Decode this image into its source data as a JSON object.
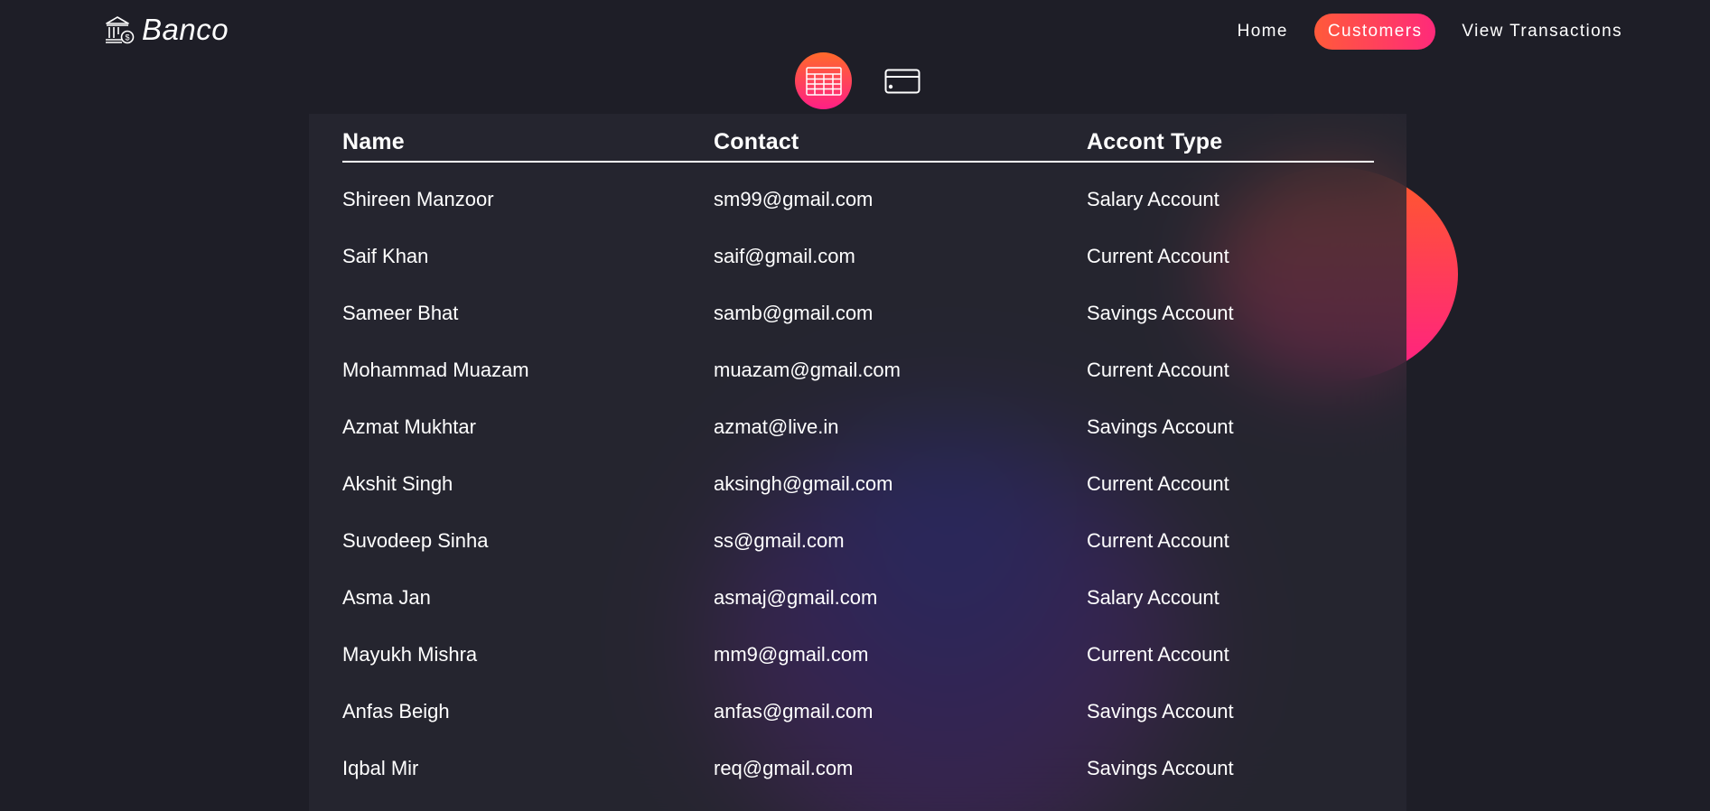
{
  "brand": {
    "name": "Banco",
    "icon": "bank-icon"
  },
  "nav": {
    "items": [
      {
        "label": "Home",
        "active": false
      },
      {
        "label": "Customers",
        "active": true
      },
      {
        "label": "View Transactions",
        "active": false
      }
    ]
  },
  "view_switch": {
    "items": [
      {
        "icon": "table-view-icon",
        "active": true
      },
      {
        "icon": "card-view-icon",
        "active": false
      }
    ]
  },
  "colors": {
    "background": "#1e1e27",
    "accent_start": "#ff5a3a",
    "accent_end": "#ff2a7a"
  },
  "table": {
    "headers": {
      "name": "Name",
      "contact": "Contact",
      "type": "Accont Type"
    },
    "rows": [
      {
        "name": "Shireen Manzoor",
        "contact": "sm99@gmail.com",
        "type": "Salary Account"
      },
      {
        "name": "Saif Khan",
        "contact": "saif@gmail.com",
        "type": "Current Account"
      },
      {
        "name": "Sameer Bhat",
        "contact": "samb@gmail.com",
        "type": "Savings Account"
      },
      {
        "name": "Mohammad Muazam",
        "contact": "muazam@gmail.com",
        "type": "Current Account"
      },
      {
        "name": "Azmat Mukhtar",
        "contact": "azmat@live.in",
        "type": "Savings Account"
      },
      {
        "name": "Akshit Singh",
        "contact": "aksingh@gmail.com",
        "type": "Current Account"
      },
      {
        "name": "Suvodeep Sinha",
        "contact": "ss@gmail.com",
        "type": "Current Account"
      },
      {
        "name": "Asma Jan",
        "contact": "asmaj@gmail.com",
        "type": "Salary Account"
      },
      {
        "name": "Mayukh Mishra",
        "contact": "mm9@gmail.com",
        "type": "Current Account"
      },
      {
        "name": "Anfas Beigh",
        "contact": "anfas@gmail.com",
        "type": "Savings Account"
      },
      {
        "name": "Iqbal Mir",
        "contact": "req@gmail.com",
        "type": "Savings Account"
      }
    ]
  }
}
